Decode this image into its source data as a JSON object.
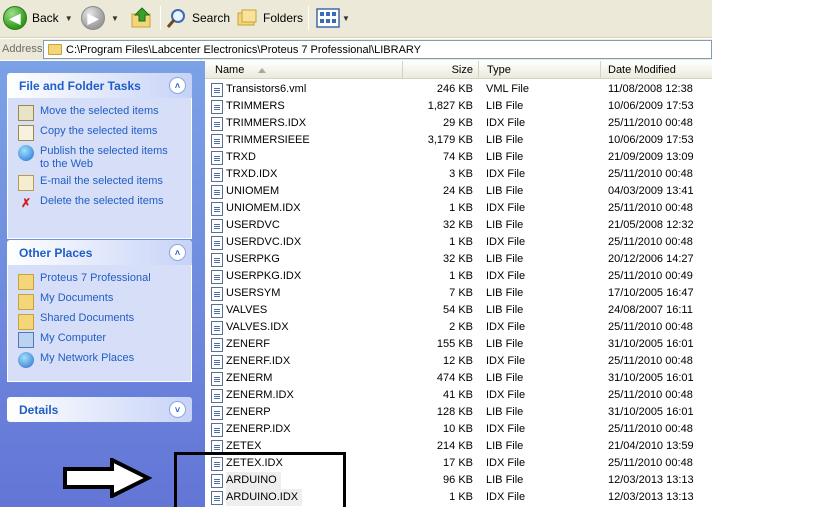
{
  "toolbar": {
    "back_label": "Back",
    "search_label": "Search",
    "folders_label": "Folders"
  },
  "address": {
    "label": "Address",
    "path": "C:\\Program Files\\Labcenter Electronics\\Proteus 7 Professional\\LIBRARY"
  },
  "sidebar": {
    "tasks": {
      "title": "File and Folder Tasks",
      "items": [
        {
          "label": "Move the selected items",
          "icon": "move-icon"
        },
        {
          "label": "Copy the selected items",
          "icon": "copy-icon"
        },
        {
          "label": "Publish the selected items to the Web",
          "icon": "web-publish-icon"
        },
        {
          "label": "E-mail the selected items",
          "icon": "email-icon"
        },
        {
          "label": "Delete the selected items",
          "icon": "delete-icon"
        }
      ]
    },
    "places": {
      "title": "Other Places",
      "items": [
        {
          "label": "Proteus 7 Professional",
          "icon": "folder-icon"
        },
        {
          "label": "My Documents",
          "icon": "folder-icon"
        },
        {
          "label": "Shared Documents",
          "icon": "folder-icon"
        },
        {
          "label": "My Computer",
          "icon": "computer-icon"
        },
        {
          "label": "My Network Places",
          "icon": "network-icon"
        }
      ]
    },
    "details": {
      "title": "Details"
    }
  },
  "columns": {
    "name": "Name",
    "size": "Size",
    "type": "Type",
    "date": "Date Modified"
  },
  "files": [
    {
      "name": "Transistors6.vml",
      "size": "246 KB",
      "type": "VML File",
      "date": "11/08/2008 12:38"
    },
    {
      "name": "TRIMMERS",
      "size": "1,827 KB",
      "type": "LIB File",
      "date": "10/06/2009 17:53"
    },
    {
      "name": "TRIMMERS.IDX",
      "size": "29 KB",
      "type": "IDX File",
      "date": "25/11/2010 00:48"
    },
    {
      "name": "TRIMMERSIEEE",
      "size": "3,179 KB",
      "type": "LIB File",
      "date": "10/06/2009 17:53"
    },
    {
      "name": "TRXD",
      "size": "74 KB",
      "type": "LIB File",
      "date": "21/09/2009 13:09"
    },
    {
      "name": "TRXD.IDX",
      "size": "3 KB",
      "type": "IDX File",
      "date": "25/11/2010 00:48"
    },
    {
      "name": "UNIOMEM",
      "size": "24 KB",
      "type": "LIB File",
      "date": "04/03/2009 13:41"
    },
    {
      "name": "UNIOMEM.IDX",
      "size": "1 KB",
      "type": "IDX File",
      "date": "25/11/2010 00:48"
    },
    {
      "name": "USERDVC",
      "size": "32 KB",
      "type": "LIB File",
      "date": "21/05/2008 12:32"
    },
    {
      "name": "USERDVC.IDX",
      "size": "1 KB",
      "type": "IDX File",
      "date": "25/11/2010 00:48"
    },
    {
      "name": "USERPKG",
      "size": "32 KB",
      "type": "LIB File",
      "date": "20/12/2006 14:27"
    },
    {
      "name": "USERPKG.IDX",
      "size": "1 KB",
      "type": "IDX File",
      "date": "25/11/2010 00:49"
    },
    {
      "name": "USERSYM",
      "size": "7 KB",
      "type": "LIB File",
      "date": "17/10/2005 16:47"
    },
    {
      "name": "VALVES",
      "size": "54 KB",
      "type": "LIB File",
      "date": "24/08/2007 16:11"
    },
    {
      "name": "VALVES.IDX",
      "size": "2 KB",
      "type": "IDX File",
      "date": "25/11/2010 00:48"
    },
    {
      "name": "ZENERF",
      "size": "155 KB",
      "type": "LIB File",
      "date": "31/10/2005 16:01"
    },
    {
      "name": "ZENERF.IDX",
      "size": "12 KB",
      "type": "IDX File",
      "date": "25/11/2010 00:48"
    },
    {
      "name": "ZENERM",
      "size": "474 KB",
      "type": "LIB File",
      "date": "31/10/2005 16:01"
    },
    {
      "name": "ZENERM.IDX",
      "size": "41 KB",
      "type": "IDX File",
      "date": "25/11/2010 00:48"
    },
    {
      "name": "ZENERP",
      "size": "128 KB",
      "type": "LIB File",
      "date": "31/10/2005 16:01"
    },
    {
      "name": "ZENERP.IDX",
      "size": "10 KB",
      "type": "IDX File",
      "date": "25/11/2010 00:48"
    },
    {
      "name": "ZETEX",
      "size": "214 KB",
      "type": "LIB File",
      "date": "21/04/2010 13:59"
    },
    {
      "name": "ZETEX.IDX",
      "size": "17 KB",
      "type": "IDX File",
      "date": "25/11/2010 00:48"
    },
    {
      "name": "ARDUINO",
      "size": "96 KB",
      "type": "LIB File",
      "date": "12/03/2013 13:13",
      "highlight": true
    },
    {
      "name": "ARDUINO.IDX",
      "size": "1 KB",
      "type": "IDX File",
      "date": "12/03/2013 13:13",
      "highlight": true
    }
  ],
  "colors": {
    "pane_top": "#7ba2e7",
    "pane_bottom": "#6375d6",
    "link": "#215dc6",
    "toolbar_bg": "#ece9d8"
  }
}
